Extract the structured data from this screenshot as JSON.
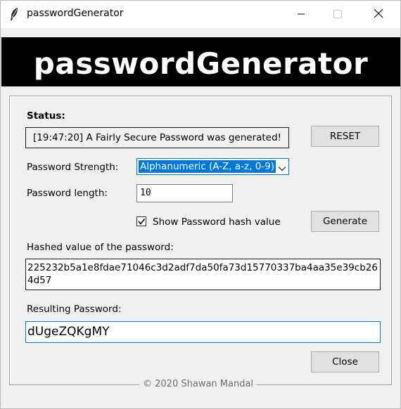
{
  "window": {
    "title": "passwordGenerator",
    "icon": "feather-icon",
    "controls": [
      "minimize-icon",
      "maximize-icon",
      "close-icon"
    ]
  },
  "banner": {
    "text": "passwordGenerator",
    "background": "#000000",
    "color": "#ffffff"
  },
  "status": {
    "label": "Status:",
    "message": "[19:47:20]  A Fairly Secure Password was generated!"
  },
  "buttons": {
    "reset": "RESET",
    "generate": "Generate",
    "close": "Close"
  },
  "strength": {
    "label": "Password Strength:",
    "selected": "Alphanumeric (A-Z, a-z, 0-9)"
  },
  "length": {
    "label": "Password length:",
    "value": "10"
  },
  "show_hash": {
    "label": "Show Password hash value",
    "checked": true
  },
  "hash": {
    "label": "Hashed value of the password:",
    "value": "225232b5a1e8fdae71046c3d2adf7da50fa73d15770337ba4aa35e39cb264d57"
  },
  "result": {
    "label": "Resulting Password:",
    "value": "dUgeZQKgMY"
  },
  "footer": {
    "caption": "© 2020 Shawan Mandal"
  },
  "colors": {
    "accent": "#0078d7",
    "window_bg": "#f0f0f0"
  }
}
